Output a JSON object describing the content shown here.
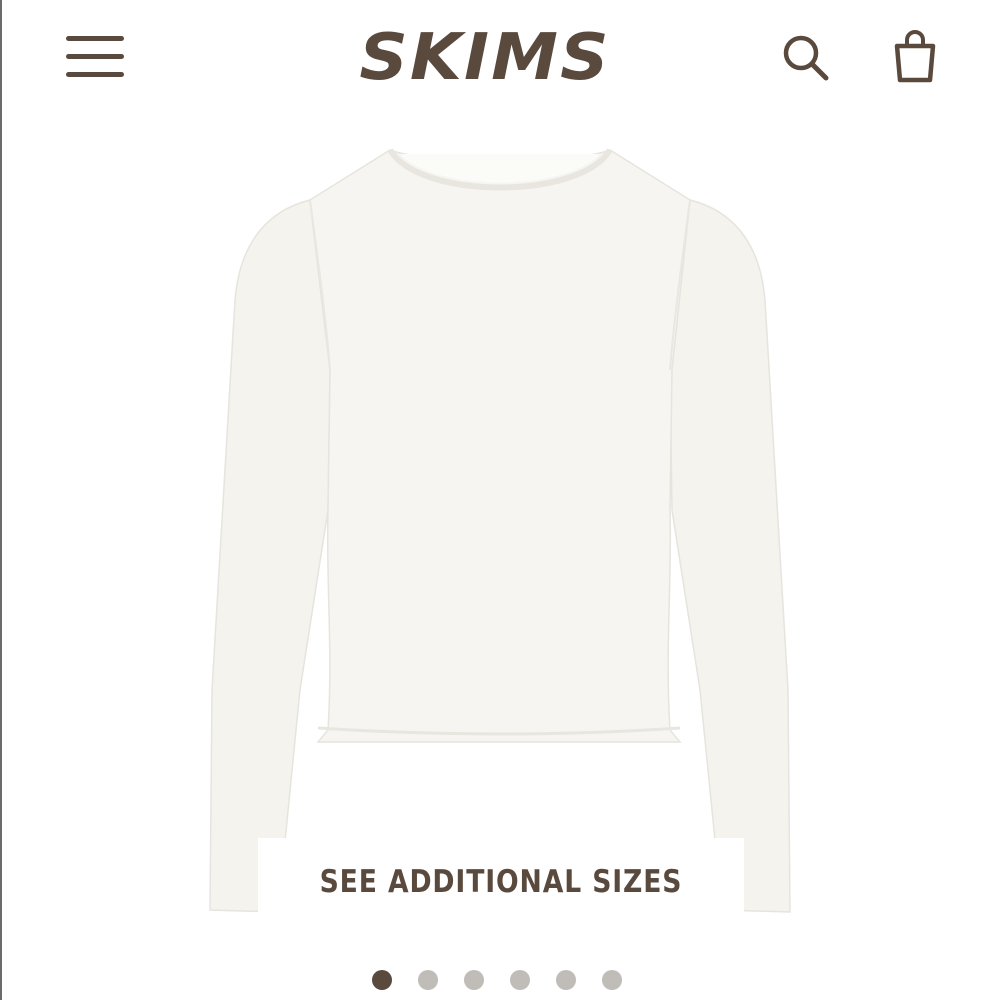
{
  "header": {
    "logo_text": "SKIMS",
    "menu_icon": "hamburger-menu-icon",
    "search_icon": "search-icon",
    "cart_icon": "shopping-bag-icon"
  },
  "product": {
    "image": "long-sleeve-crew-neck-top-white"
  },
  "sizes_button": {
    "label": "SEE ADDITIONAL SIZES"
  },
  "carousel": {
    "total": 6,
    "active_index": 0
  },
  "colors": {
    "brand": "#5a4a3e",
    "dot_inactive": "#c0bcb8",
    "garment": "#f4f3ee"
  }
}
